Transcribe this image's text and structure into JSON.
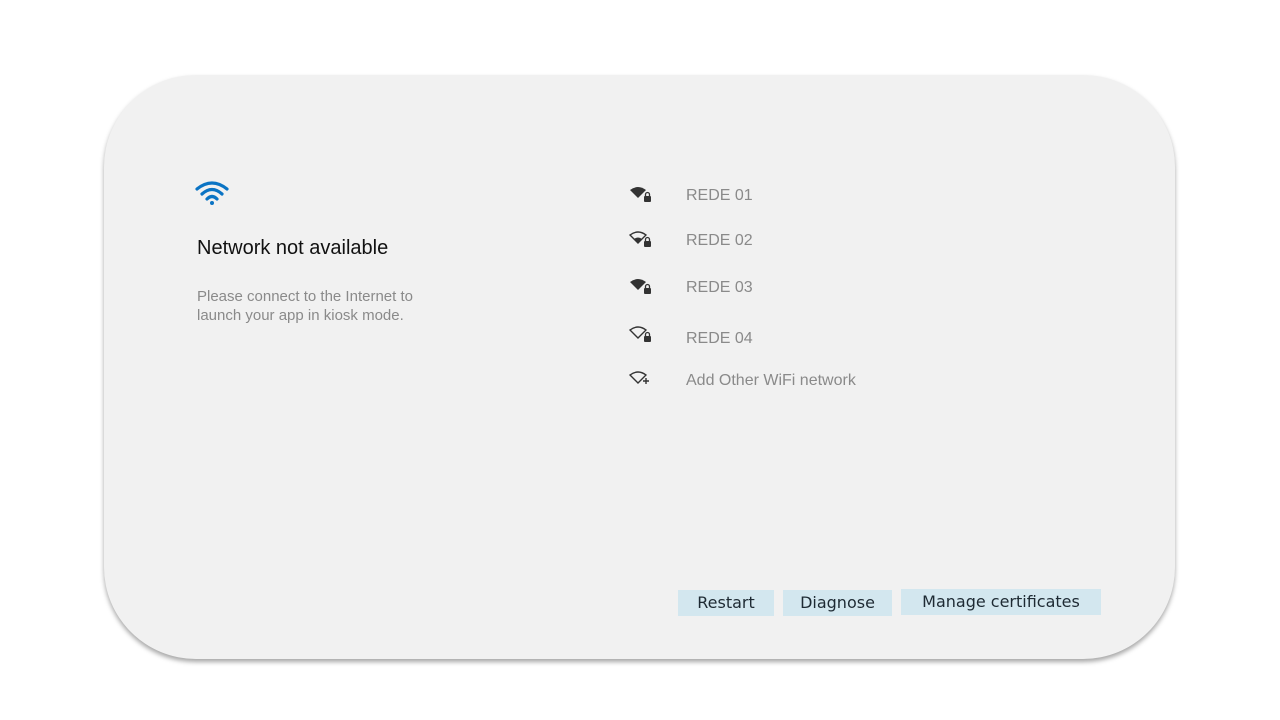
{
  "status": {
    "title": "Network not available",
    "message": "Please connect to the Internet to launch your app in kiosk mode.",
    "icon": "wifi-icon",
    "icon_color": "#0b74c4"
  },
  "networks": [
    {
      "label": "REDE 01",
      "icon": "wifi-locked-icon",
      "signal": "full"
    },
    {
      "label": "REDE 02",
      "icon": "wifi-locked-icon",
      "signal": "medium"
    },
    {
      "label": "REDE 03",
      "icon": "wifi-locked-icon",
      "signal": "full"
    },
    {
      "label": "REDE 04",
      "icon": "wifi-locked-icon",
      "signal": "low"
    }
  ],
  "add_network": {
    "label": "Add Other WiFi network",
    "icon": "wifi-add-icon"
  },
  "actions": {
    "restart": "Restart",
    "diagnose": "Diagnose",
    "manage_certificates": "Manage certificates"
  },
  "colors": {
    "card_background": "#f1f1f1",
    "button_background": "#d3e7ef",
    "muted_text": "#8a8a8a"
  }
}
